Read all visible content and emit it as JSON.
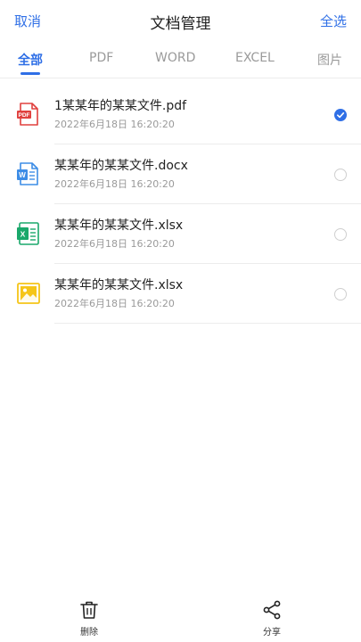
{
  "header": {
    "cancel_label": "取消",
    "title": "文档管理",
    "select_all_label": "全选"
  },
  "tabs": [
    {
      "label": "全部",
      "active": true
    },
    {
      "label": "PDF",
      "active": false
    },
    {
      "label": "WORD",
      "active": false
    },
    {
      "label": "EXCEL",
      "active": false
    },
    {
      "label": "图片",
      "active": false
    }
  ],
  "files": [
    {
      "name": "1某某年的某某文件.pdf",
      "date": "2022年6月18日  16:20:20",
      "type": "pdf",
      "icon": "pdf-file-icon",
      "checked": true
    },
    {
      "name": "某某年的某某文件.docx",
      "date": "2022年6月18日  16:20:20",
      "type": "word",
      "icon": "word-file-icon",
      "checked": false
    },
    {
      "name": "某某年的某某文件.xlsx",
      "date": "2022年6月18日  16:20:20",
      "type": "excel",
      "icon": "excel-file-icon",
      "checked": false
    },
    {
      "name": "某某年的某某文件.xlsx",
      "date": "2022年6月18日  16:20:20",
      "type": "image",
      "icon": "image-file-icon",
      "checked": false
    }
  ],
  "actions": {
    "delete_label": "删除",
    "share_label": "分享"
  },
  "colors": {
    "accent": "#2f6fe6",
    "pdf": "#e0403e",
    "word": "#3d8de6",
    "excel": "#1aa86b",
    "image": "#f5c518"
  }
}
